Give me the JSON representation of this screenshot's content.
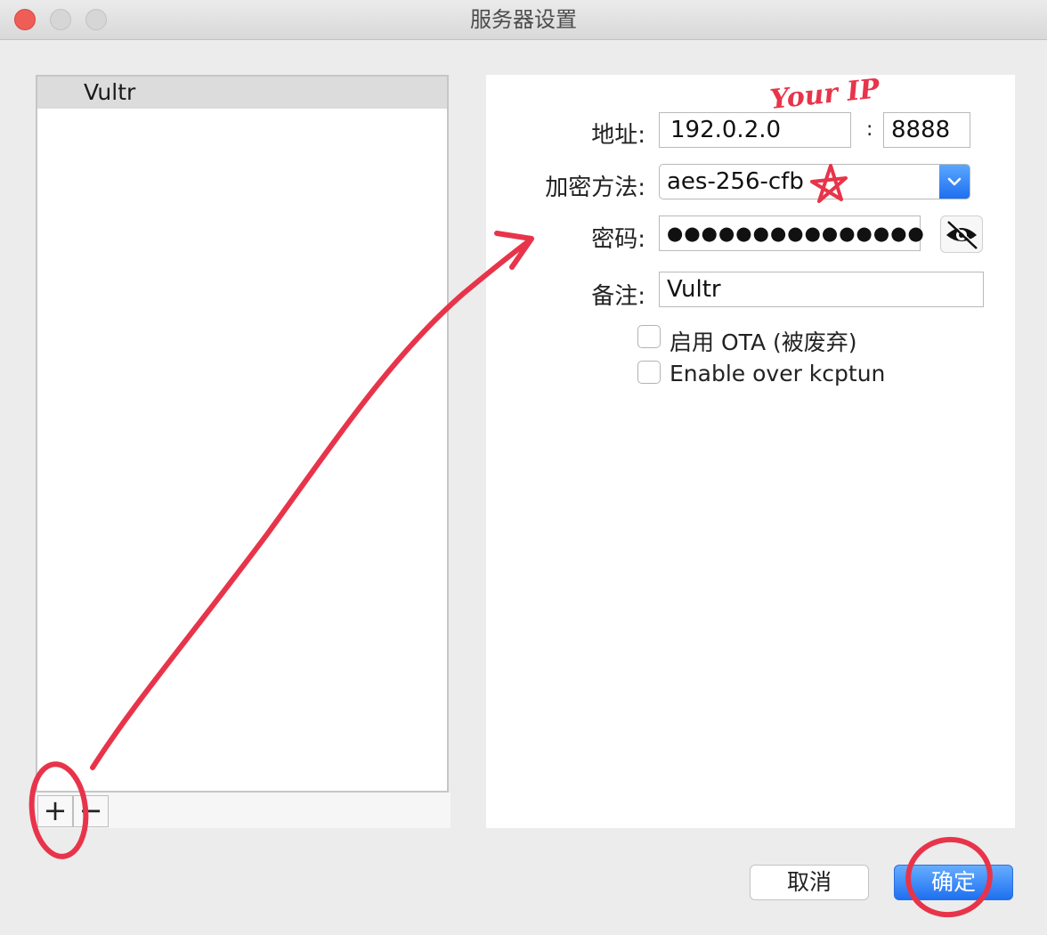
{
  "window": {
    "title": "服务器设置"
  },
  "server_list": {
    "items": [
      {
        "label": "Vultr"
      }
    ],
    "add_label": "+",
    "remove_label": "−"
  },
  "form": {
    "address_label": "地址:",
    "address_value": "192.0.2.0",
    "port_separator": ":",
    "port_value": "8888",
    "encryption_label": "加密方法:",
    "encryption_value": "aes-256-cfb",
    "password_label": "密码:",
    "password_value": "●●●●●●●●●●●●●●●",
    "remark_label": "备注:",
    "remark_value": "Vultr",
    "ota_label": "启用 OTA (被废弃)",
    "kcptun_label": "Enable over kcptun"
  },
  "buttons": {
    "cancel_label": "取消",
    "ok_label": "确定"
  },
  "annotations": {
    "handwritten_note": "Your IP",
    "color": "#e8344a"
  },
  "colors": {
    "accent": "#1f70f0",
    "close": "#ee5e57"
  },
  "icons": {
    "eye_toggle": "eye-slash-icon",
    "select_arrow": "chevron-down-icon"
  }
}
